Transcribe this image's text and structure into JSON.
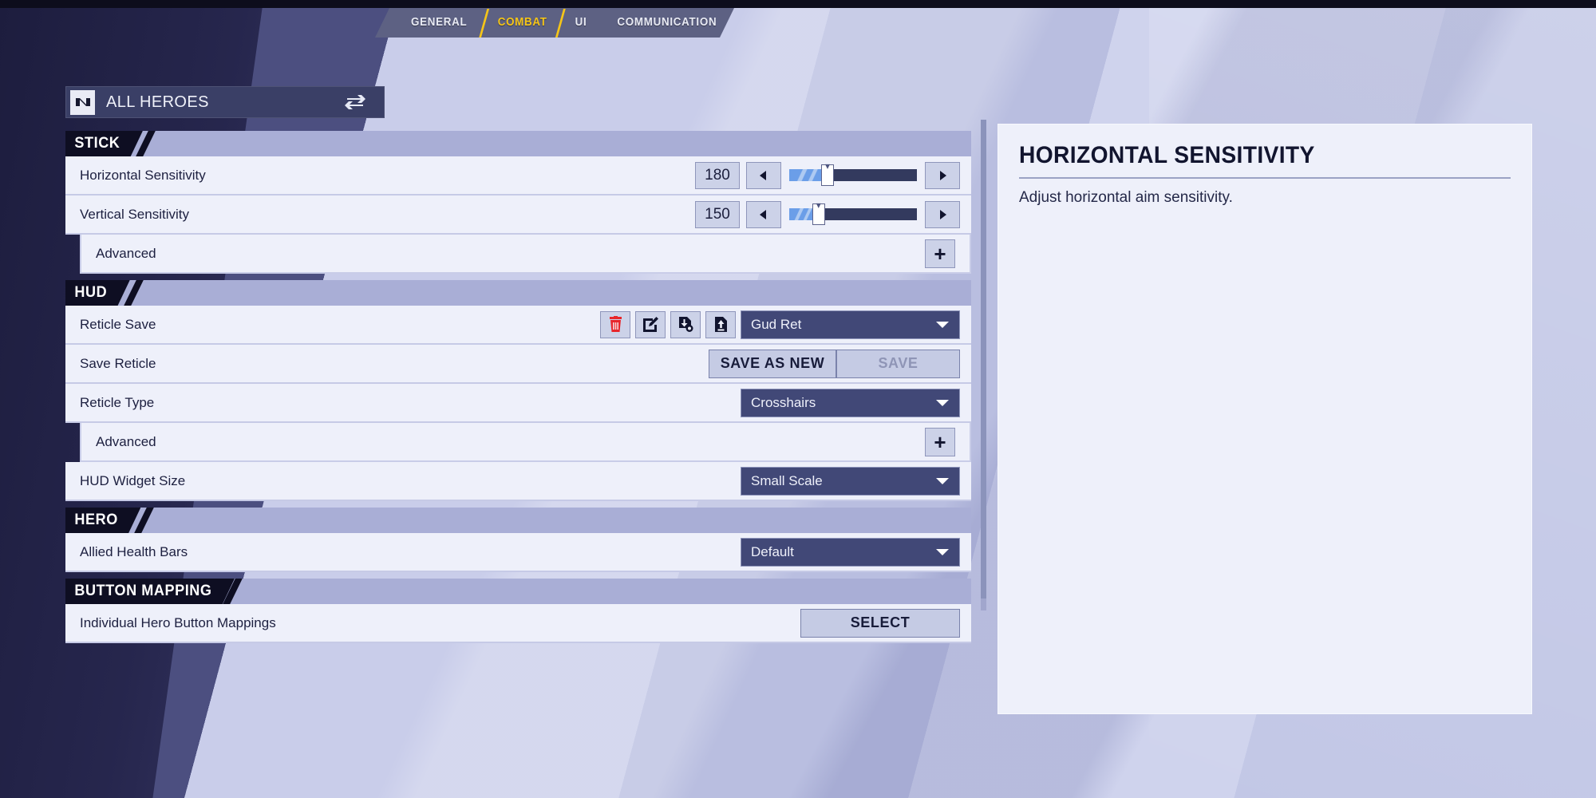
{
  "tabs": [
    {
      "label": "GENERAL",
      "active": false
    },
    {
      "label": "COMBAT",
      "active": true
    },
    {
      "label": "UI",
      "active": false
    },
    {
      "label": "COMMUNICATION",
      "active": false
    }
  ],
  "hero_header": {
    "title": "ALL HEROES",
    "left_icon": "hero-roster-icon",
    "right_icon": "swap-icon"
  },
  "sections": [
    {
      "name": "STICK",
      "rows": [
        {
          "type": "slider",
          "label": "Horizontal Sensitivity",
          "value": "180",
          "fill_percent": 30,
          "marker_percent": 30,
          "dec_icon": "arrow-left-icon",
          "inc_icon": "arrow-right-icon"
        },
        {
          "type": "slider",
          "label": "Vertical Sensitivity",
          "value": "150",
          "fill_percent": 23,
          "marker_percent": 23,
          "dec_icon": "arrow-left-icon",
          "inc_icon": "arrow-right-icon"
        },
        {
          "type": "expand",
          "label": "Advanced",
          "button_label": "+"
        }
      ]
    },
    {
      "name": "HUD",
      "rows": [
        {
          "type": "reticle-save",
          "label": "Reticle Save",
          "icons": [
            "delete-icon",
            "edit-icon",
            "import-icon",
            "export-icon"
          ],
          "dropdown_value": "Gud Ret"
        },
        {
          "type": "save-buttons",
          "label": "Save Reticle",
          "primary_label": "SAVE AS NEW",
          "secondary_label": "SAVE",
          "secondary_disabled": true
        },
        {
          "type": "dropdown",
          "label": "Reticle Type",
          "dropdown_value": "Crosshairs"
        },
        {
          "type": "expand",
          "label": "Advanced",
          "button_label": "+"
        },
        {
          "type": "dropdown",
          "label": "HUD Widget Size",
          "dropdown_value": "Small Scale"
        }
      ]
    },
    {
      "name": "HERO",
      "rows": [
        {
          "type": "dropdown",
          "label": "Allied Health Bars",
          "dropdown_value": "Default"
        }
      ]
    },
    {
      "name": "BUTTON MAPPING",
      "rows": [
        {
          "type": "select",
          "label": "Individual Hero Button Mappings",
          "button_label": "SELECT"
        }
      ]
    }
  ],
  "info_panel": {
    "title": "HORIZONTAL SENSITIVITY",
    "body": "Adjust horizontal aim sensitivity."
  },
  "colors": {
    "accent_yellow": "#f5c518",
    "slider_fill": "#6b9ee8",
    "slider_track": "#333a5e",
    "dropdown_bg": "#414877",
    "row_bg": "#eef0fa",
    "section_chip": "#0e0e22",
    "delete_red": "#e8262b"
  }
}
